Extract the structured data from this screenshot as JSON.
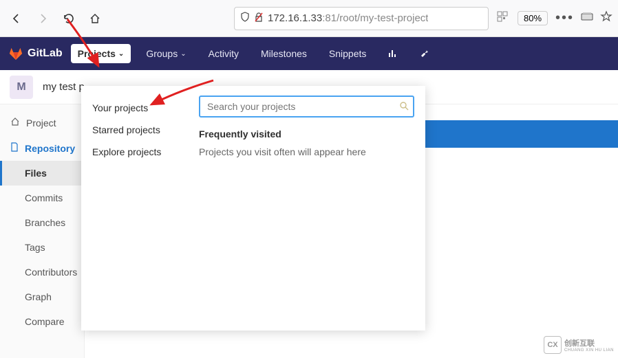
{
  "browser": {
    "url_prefix": "172.16.1.33",
    "url_suffix": ":81/root/my-test-project",
    "zoom": "80%"
  },
  "nav": {
    "brand": "GitLab",
    "items": [
      {
        "label": "Projects",
        "has_chevron": true,
        "active": true
      },
      {
        "label": "Groups",
        "has_chevron": true
      },
      {
        "label": "Activity"
      },
      {
        "label": "Milestones"
      },
      {
        "label": "Snippets"
      }
    ]
  },
  "project": {
    "avatar_letter": "M",
    "name": "my test p"
  },
  "sidebar": {
    "top": [
      {
        "icon": "home",
        "label": "Project"
      },
      {
        "icon": "doc",
        "label": "Repository",
        "active": true
      }
    ],
    "sub": [
      {
        "label": "Files",
        "active": true
      },
      {
        "label": "Commits"
      },
      {
        "label": "Branches"
      },
      {
        "label": "Tags"
      },
      {
        "label": "Contributors"
      },
      {
        "label": "Graph"
      },
      {
        "label": "Compare"
      }
    ]
  },
  "dropdown": {
    "left_items": [
      {
        "label": "Your projects"
      },
      {
        "label": "Starred projects"
      },
      {
        "label": "Explore projects"
      }
    ],
    "search_placeholder": "Search your projects",
    "heading": "Frequently visited",
    "empty_text": "Projects you visit often will appear here"
  },
  "watermark": {
    "text": "创新互联",
    "sub": "CHUANG XIN HU LIAN"
  }
}
